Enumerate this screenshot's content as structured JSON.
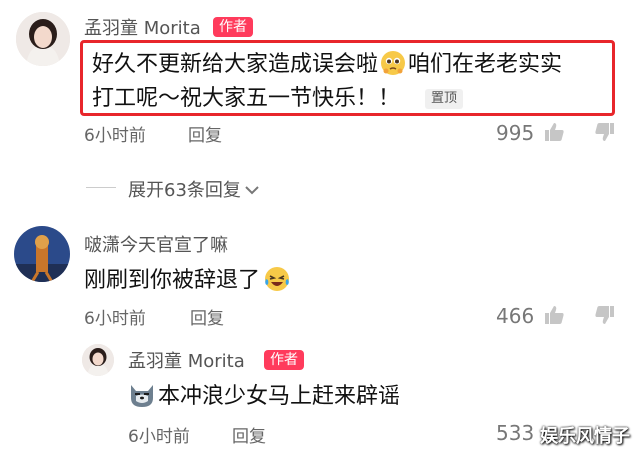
{
  "comments": [
    {
      "author": "孟羽童 Morita",
      "author_tag": "作者",
      "text_line1_a": "好久不更新给大家造成误会啦",
      "text_line1_b": "咱们在老老实实",
      "text_line2": "打工呢～祝大家五一节快乐！！",
      "pin_tag": "置顶",
      "time": "6小时前",
      "reply_label": "回复",
      "likes": "995",
      "expand_label": "展开63条回复"
    },
    {
      "author": "啵潇今天官宣了嘛",
      "text": "刚刷到你被辞退了",
      "time": "6小时前",
      "reply_label": "回复",
      "likes": "466"
    },
    {
      "author": "孟羽童 Morita",
      "author_tag": "作者",
      "text": "本冲浪少女马上赶来辟谣",
      "time": "6小时前",
      "reply_label": "回复",
      "likes": "533"
    }
  ],
  "watermark": "娱乐风情子",
  "colors": {
    "author_tag": "#ff3b5c",
    "highlight": "#e8262b"
  }
}
